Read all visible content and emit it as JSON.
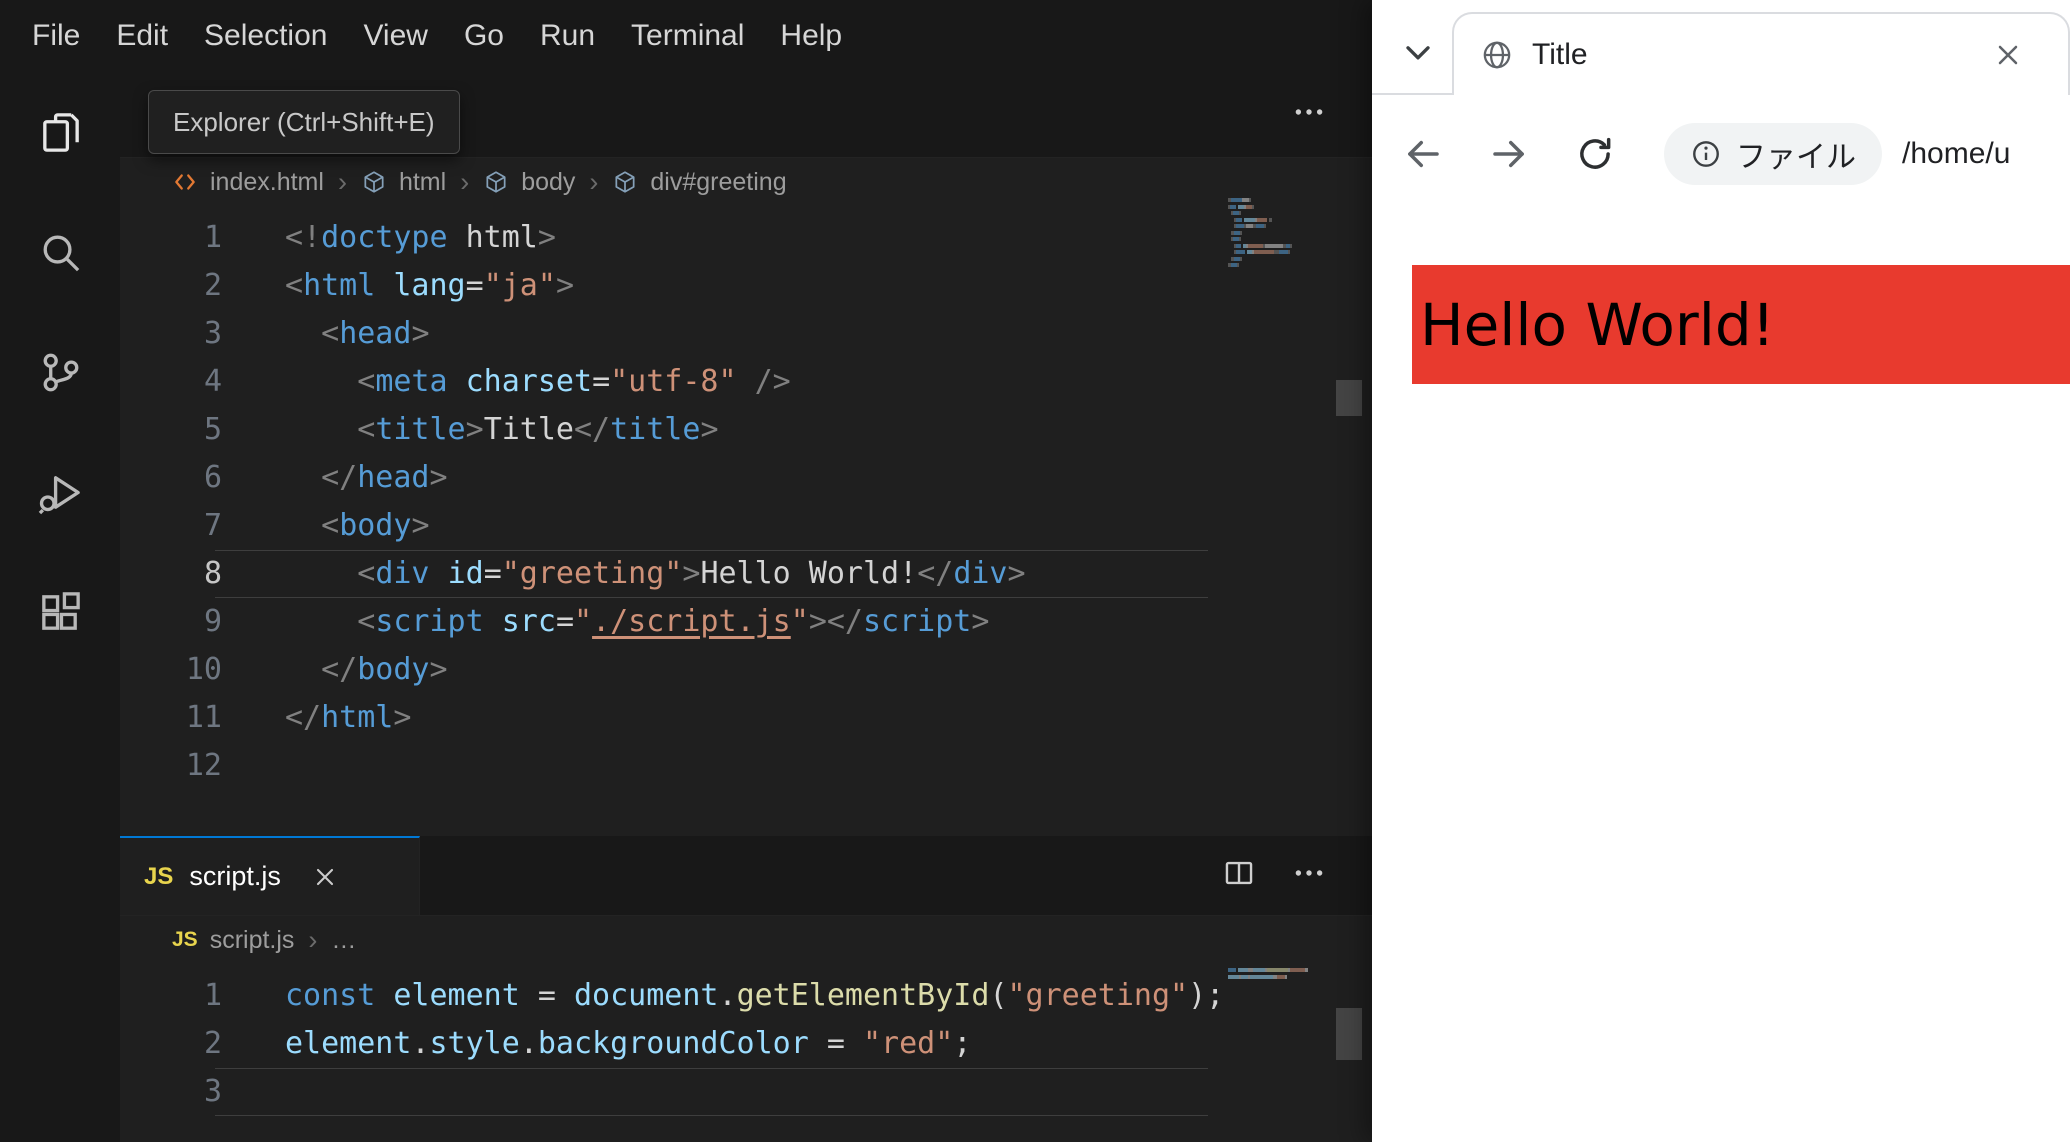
{
  "colors": {
    "accent": "#0078d4",
    "page_red": "#e83a2e"
  },
  "vscode": {
    "menu": [
      "File",
      "Edit",
      "Selection",
      "View",
      "Go",
      "Run",
      "Terminal",
      "Help"
    ],
    "tooltip": "Explorer (Ctrl+Shift+E)",
    "activity": [
      "explorer",
      "search",
      "source-control",
      "run-debug",
      "extensions"
    ],
    "html_editor": {
      "breadcrumb": {
        "file": "index.html",
        "segments": [
          "html",
          "body",
          "div#greeting"
        ]
      },
      "active_line": 8,
      "lines": [
        [
          {
            "c": "punct",
            "t": "<!"
          },
          {
            "c": "tag",
            "t": "doctype"
          },
          {
            "c": "plain",
            "t": " html"
          },
          {
            "c": "punct",
            "t": ">"
          }
        ],
        [
          {
            "c": "punct",
            "t": "<"
          },
          {
            "c": "tag",
            "t": "html"
          },
          {
            "c": "plain",
            "t": " "
          },
          {
            "c": "attr",
            "t": "lang"
          },
          {
            "c": "plain",
            "t": "="
          },
          {
            "c": "str",
            "t": "\"ja\""
          },
          {
            "c": "punct",
            "t": ">"
          }
        ],
        [
          {
            "c": "plain",
            "t": "  "
          },
          {
            "c": "punct",
            "t": "<"
          },
          {
            "c": "tag",
            "t": "head"
          },
          {
            "c": "punct",
            "t": ">"
          }
        ],
        [
          {
            "c": "plain",
            "t": "    "
          },
          {
            "c": "punct",
            "t": "<"
          },
          {
            "c": "tag",
            "t": "meta"
          },
          {
            "c": "plain",
            "t": " "
          },
          {
            "c": "attr",
            "t": "charset"
          },
          {
            "c": "plain",
            "t": "="
          },
          {
            "c": "str",
            "t": "\"utf-8\""
          },
          {
            "c": "plain",
            "t": " "
          },
          {
            "c": "punct",
            "t": "/>"
          }
        ],
        [
          {
            "c": "plain",
            "t": "    "
          },
          {
            "c": "punct",
            "t": "<"
          },
          {
            "c": "tag",
            "t": "title"
          },
          {
            "c": "punct",
            "t": ">"
          },
          {
            "c": "plain",
            "t": "Title"
          },
          {
            "c": "punct",
            "t": "</"
          },
          {
            "c": "tag",
            "t": "title"
          },
          {
            "c": "punct",
            "t": ">"
          }
        ],
        [
          {
            "c": "plain",
            "t": "  "
          },
          {
            "c": "punct",
            "t": "</"
          },
          {
            "c": "tag",
            "t": "head"
          },
          {
            "c": "punct",
            "t": ">"
          }
        ],
        [
          {
            "c": "plain",
            "t": "  "
          },
          {
            "c": "punct",
            "t": "<"
          },
          {
            "c": "tag",
            "t": "body"
          },
          {
            "c": "punct",
            "t": ">"
          }
        ],
        [
          {
            "c": "plain",
            "t": "    "
          },
          {
            "c": "punct",
            "t": "<"
          },
          {
            "c": "tag",
            "t": "div"
          },
          {
            "c": "plain",
            "t": " "
          },
          {
            "c": "attr",
            "t": "id"
          },
          {
            "c": "plain",
            "t": "="
          },
          {
            "c": "str",
            "t": "\"greeting\""
          },
          {
            "c": "punct",
            "t": ">"
          },
          {
            "c": "plain",
            "t": "Hello World!"
          },
          {
            "c": "punct",
            "t": "</"
          },
          {
            "c": "tag",
            "t": "div"
          },
          {
            "c": "punct",
            "t": ">"
          }
        ],
        [
          {
            "c": "plain",
            "t": "    "
          },
          {
            "c": "punct",
            "t": "<"
          },
          {
            "c": "tag",
            "t": "script"
          },
          {
            "c": "plain",
            "t": " "
          },
          {
            "c": "attr",
            "t": "src"
          },
          {
            "c": "plain",
            "t": "="
          },
          {
            "c": "str",
            "t": "\""
          },
          {
            "c": "link",
            "t": "./script.js"
          },
          {
            "c": "str",
            "t": "\""
          },
          {
            "c": "punct",
            "t": ">"
          },
          {
            "c": "punct",
            "t": "</"
          },
          {
            "c": "tag",
            "t": "script"
          },
          {
            "c": "punct",
            "t": ">"
          }
        ],
        [
          {
            "c": "plain",
            "t": "  "
          },
          {
            "c": "punct",
            "t": "</"
          },
          {
            "c": "tag",
            "t": "body"
          },
          {
            "c": "punct",
            "t": ">"
          }
        ],
        [
          {
            "c": "punct",
            "t": "</"
          },
          {
            "c": "tag",
            "t": "html"
          },
          {
            "c": "punct",
            "t": ">"
          }
        ],
        []
      ]
    },
    "js_editor": {
      "tab": {
        "icon": "JS",
        "label": "script.js"
      },
      "breadcrumb": {
        "icon": "JS",
        "file": "script.js",
        "more": "…"
      },
      "active_line": 3,
      "lines": [
        [
          {
            "c": "kw",
            "t": "const"
          },
          {
            "c": "plain",
            "t": " "
          },
          {
            "c": "var",
            "t": "element"
          },
          {
            "c": "plain",
            "t": " = "
          },
          {
            "c": "var",
            "t": "document"
          },
          {
            "c": "plain",
            "t": "."
          },
          {
            "c": "fn",
            "t": "getElementById"
          },
          {
            "c": "plain",
            "t": "("
          },
          {
            "c": "str",
            "t": "\"greeting\""
          },
          {
            "c": "plain",
            "t": ");"
          }
        ],
        [
          {
            "c": "var",
            "t": "element"
          },
          {
            "c": "plain",
            "t": "."
          },
          {
            "c": "var",
            "t": "style"
          },
          {
            "c": "plain",
            "t": "."
          },
          {
            "c": "var",
            "t": "backgroundColor"
          },
          {
            "c": "plain",
            "t": " = "
          },
          {
            "c": "str",
            "t": "\"red\""
          },
          {
            "c": "plain",
            "t": ";"
          }
        ],
        []
      ]
    }
  },
  "browser": {
    "tab": {
      "title": "Title"
    },
    "navbar": {
      "chip_label": "ファイル",
      "path": "/home/u"
    },
    "page": {
      "greeting": "Hello World!"
    }
  }
}
